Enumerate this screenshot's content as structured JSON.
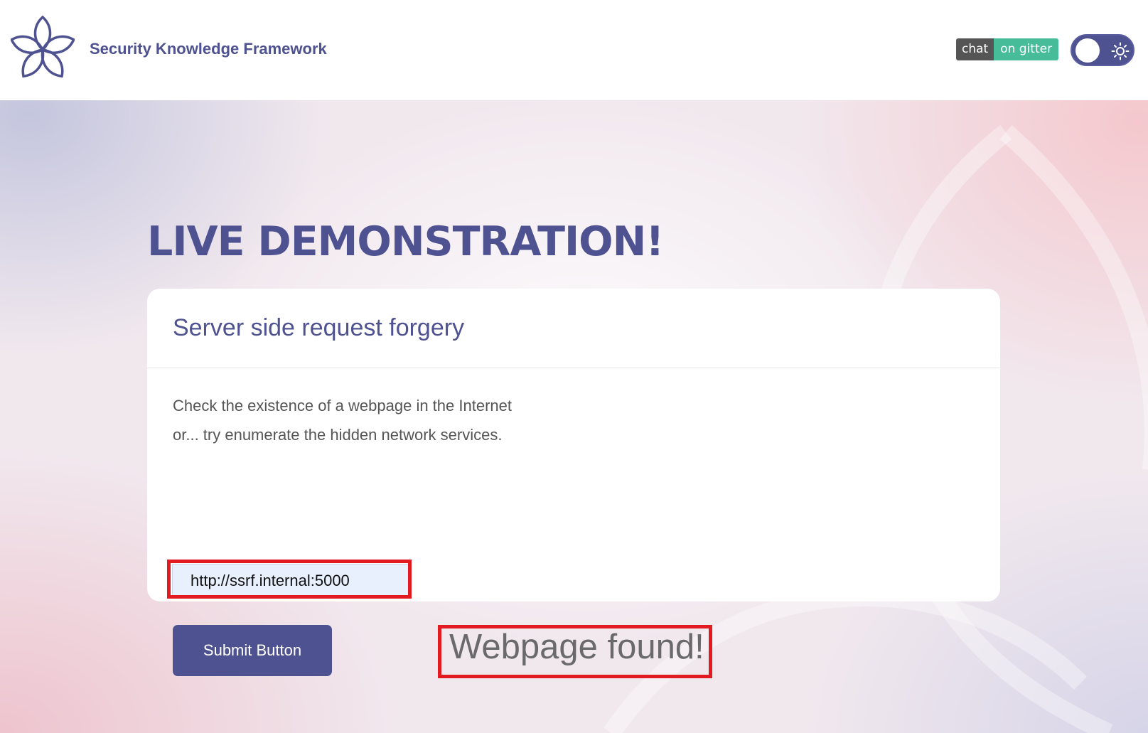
{
  "header": {
    "brand": "Security Knowledge Framework",
    "gitter_left": "chat",
    "gitter_right": "on gitter",
    "logo_icon": "flower-logo-icon",
    "theme_icon": "sun-icon"
  },
  "main": {
    "heading": "LIVE DEMONSTRATION!",
    "card_title": "Server side request forgery",
    "description_line1": "Check the existence of a webpage in the Internet",
    "description_line2": "or... try enumerate the hidden network services.",
    "url_value": "http://ssrf.internal:5000",
    "submit_label": "Submit Button",
    "result": "Webpage found!"
  },
  "colors": {
    "accent": "#4f5291",
    "highlight": "#e21b23",
    "gitter_green": "#46bc99",
    "gitter_dark": "#555555"
  }
}
